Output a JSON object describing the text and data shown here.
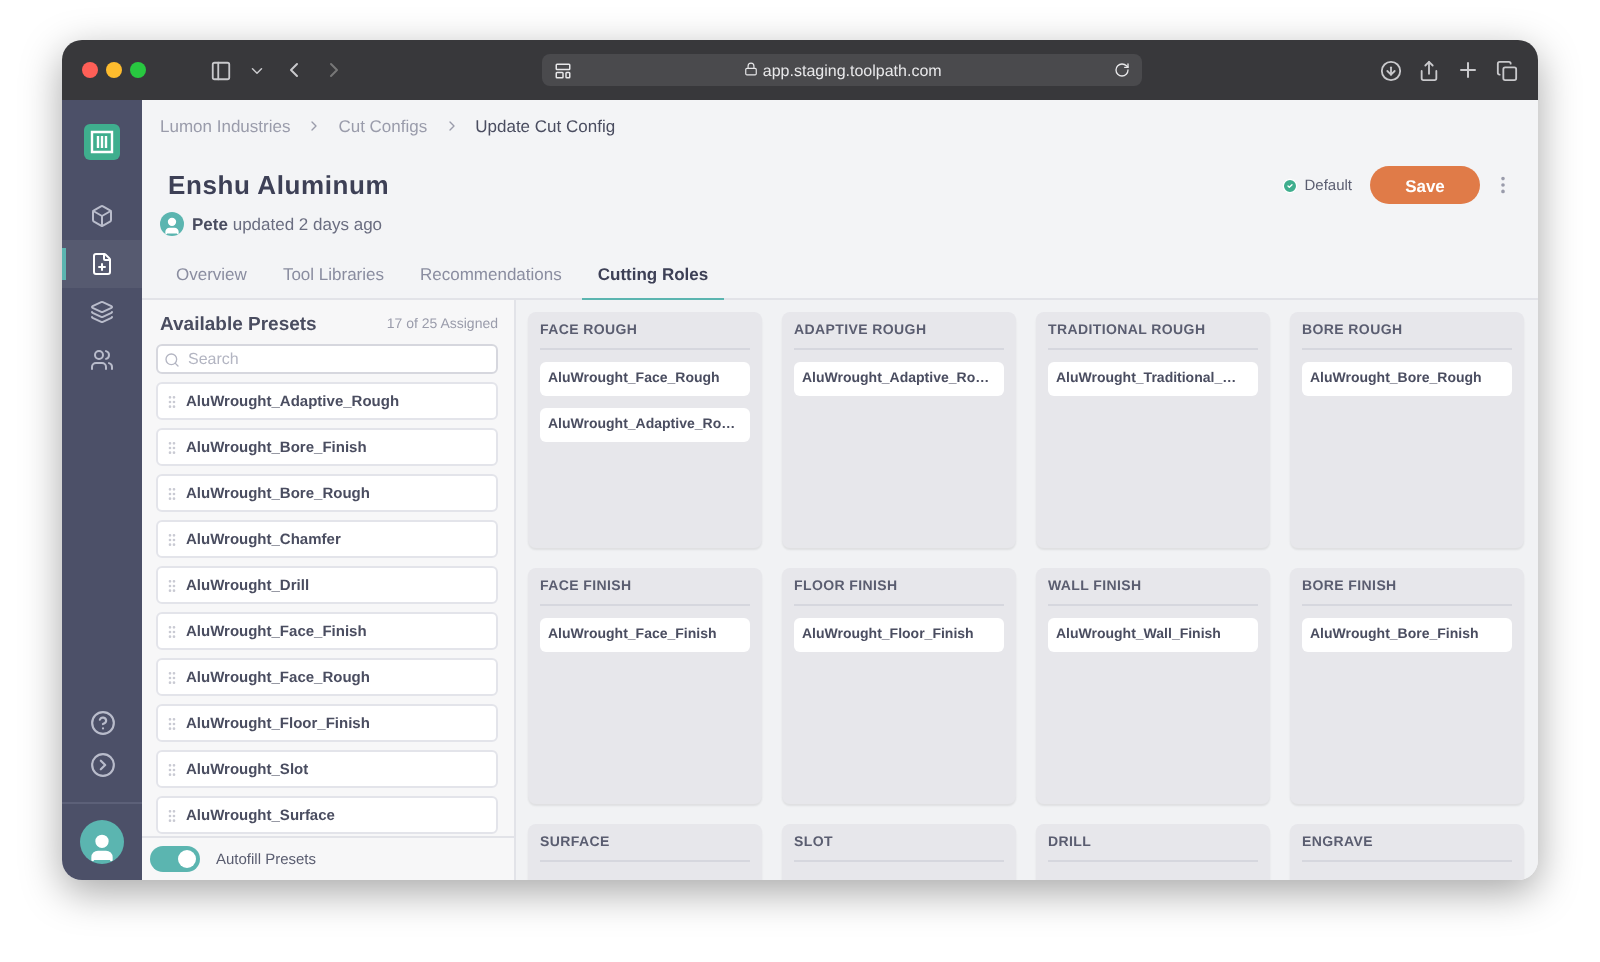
{
  "browser": {
    "url": "app.staging.toolpath.com"
  },
  "sidebar": {
    "nav": [
      {
        "selected": false
      },
      {
        "selected": true
      },
      {
        "selected": false
      },
      {
        "selected": false
      }
    ]
  },
  "breadcrumbs": [
    "Lumon Industries",
    "Cut Configs",
    "Update Cut Config"
  ],
  "header": {
    "title": "Enshu Aluminum",
    "author": "Pete",
    "updated": "updated 2 days ago",
    "badge": "Default",
    "save": "Save"
  },
  "tabs": [
    {
      "label": "Overview",
      "selected": false
    },
    {
      "label": "Tool Libraries",
      "selected": false
    },
    {
      "label": "Recommendations",
      "selected": false
    },
    {
      "label": "Cutting Roles",
      "selected": true
    }
  ],
  "presets": {
    "title": "Available Presets",
    "count": "17 of 25 Assigned",
    "search_placeholder": "Search",
    "items": [
      "AluWrought_Adaptive_Rough",
      "AluWrought_Bore_Finish",
      "AluWrought_Bore_Rough",
      "AluWrought_Chamfer",
      "AluWrought_Drill",
      "AluWrought_Face_Finish",
      "AluWrought_Face_Rough",
      "AluWrought_Floor_Finish",
      "AluWrought_Slot",
      "AluWrought_Surface"
    ],
    "autofill": {
      "label": "Autofill Presets",
      "on": true
    }
  },
  "roles": [
    {
      "name": "FACE ROUGH",
      "presets": [
        "AluWrought_Face_Rough",
        "AluWrought_Adaptive_Ro…"
      ]
    },
    {
      "name": "ADAPTIVE ROUGH",
      "presets": [
        "AluWrought_Adaptive_Ro…"
      ]
    },
    {
      "name": "TRADITIONAL ROUGH",
      "presets": [
        "AluWrought_Traditional_…"
      ]
    },
    {
      "name": "BORE ROUGH",
      "presets": [
        "AluWrought_Bore_Rough"
      ]
    },
    {
      "name": "FACE FINISH",
      "presets": [
        "AluWrought_Face_Finish"
      ]
    },
    {
      "name": "FLOOR FINISH",
      "presets": [
        "AluWrought_Floor_Finish"
      ]
    },
    {
      "name": "WALL FINISH",
      "presets": [
        "AluWrought_Wall_Finish"
      ]
    },
    {
      "name": "BORE FINISH",
      "presets": [
        "AluWrought_Bore_Finish"
      ]
    },
    {
      "name": "SURFACE"
    },
    {
      "name": "SLOT"
    },
    {
      "name": "DRILL"
    },
    {
      "name": "ENGRAVE"
    }
  ]
}
